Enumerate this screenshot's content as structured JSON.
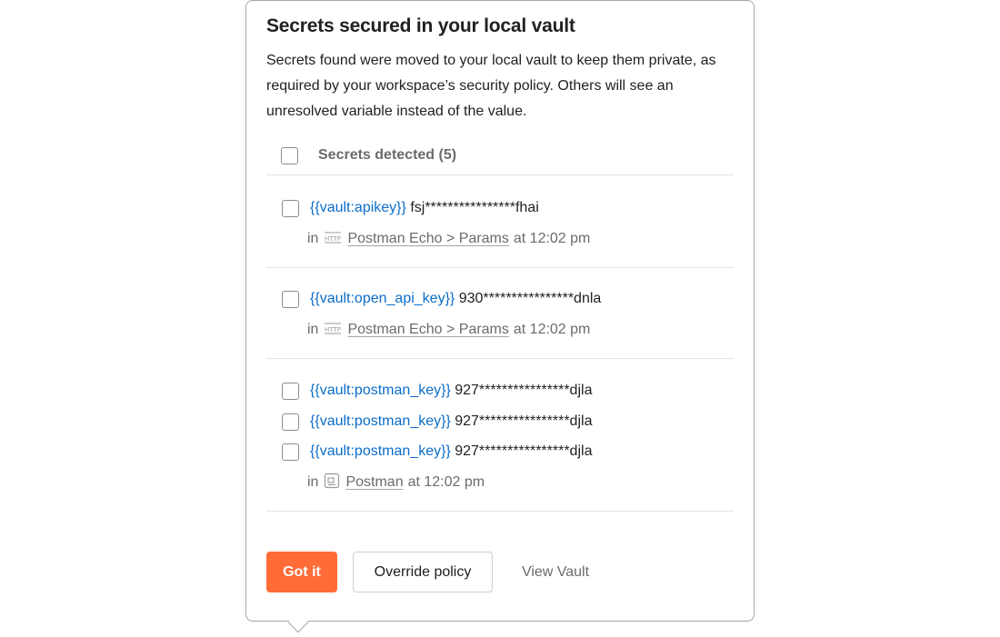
{
  "dialog": {
    "title": "Secrets secured in your local vault",
    "description": "Secrets found were moved to your local vault to keep them private, as required by your workspace’s security policy. Others will see an unresolved variable instead of the value."
  },
  "section": {
    "label": "Secrets detected (5)"
  },
  "groups": [
    {
      "secrets": [
        {
          "variable": "{{vault:apikey}}",
          "masked": "fsj****************fhai"
        }
      ],
      "location": {
        "prefix": "in",
        "icon": "http-icon",
        "name": "Postman Echo > Params",
        "time": "at 12:02 pm"
      }
    },
    {
      "secrets": [
        {
          "variable": "{{vault:open_api_key}}",
          "masked": "930****************dnla"
        }
      ],
      "location": {
        "prefix": "in",
        "icon": "http-icon",
        "name": "Postman Echo > Params",
        "time": "at 12:02 pm"
      }
    },
    {
      "secrets": [
        {
          "variable": "{{vault:postman_key}}",
          "masked": "927****************djla"
        },
        {
          "variable": "{{vault:postman_key}}",
          "masked": "927****************djla"
        },
        {
          "variable": "{{vault:postman_key}}",
          "masked": "927****************djla"
        }
      ],
      "location": {
        "prefix": "in",
        "icon": "environment-icon",
        "name": "Postman",
        "time": "at 12:02 pm"
      }
    }
  ],
  "actions": {
    "primary": "Got it",
    "secondary": "Override policy",
    "tertiary": "View Vault"
  },
  "colors": {
    "primary": "#ff6c37",
    "variable_link": "#0b6dc9",
    "muted_text": "#6b6b6b"
  }
}
